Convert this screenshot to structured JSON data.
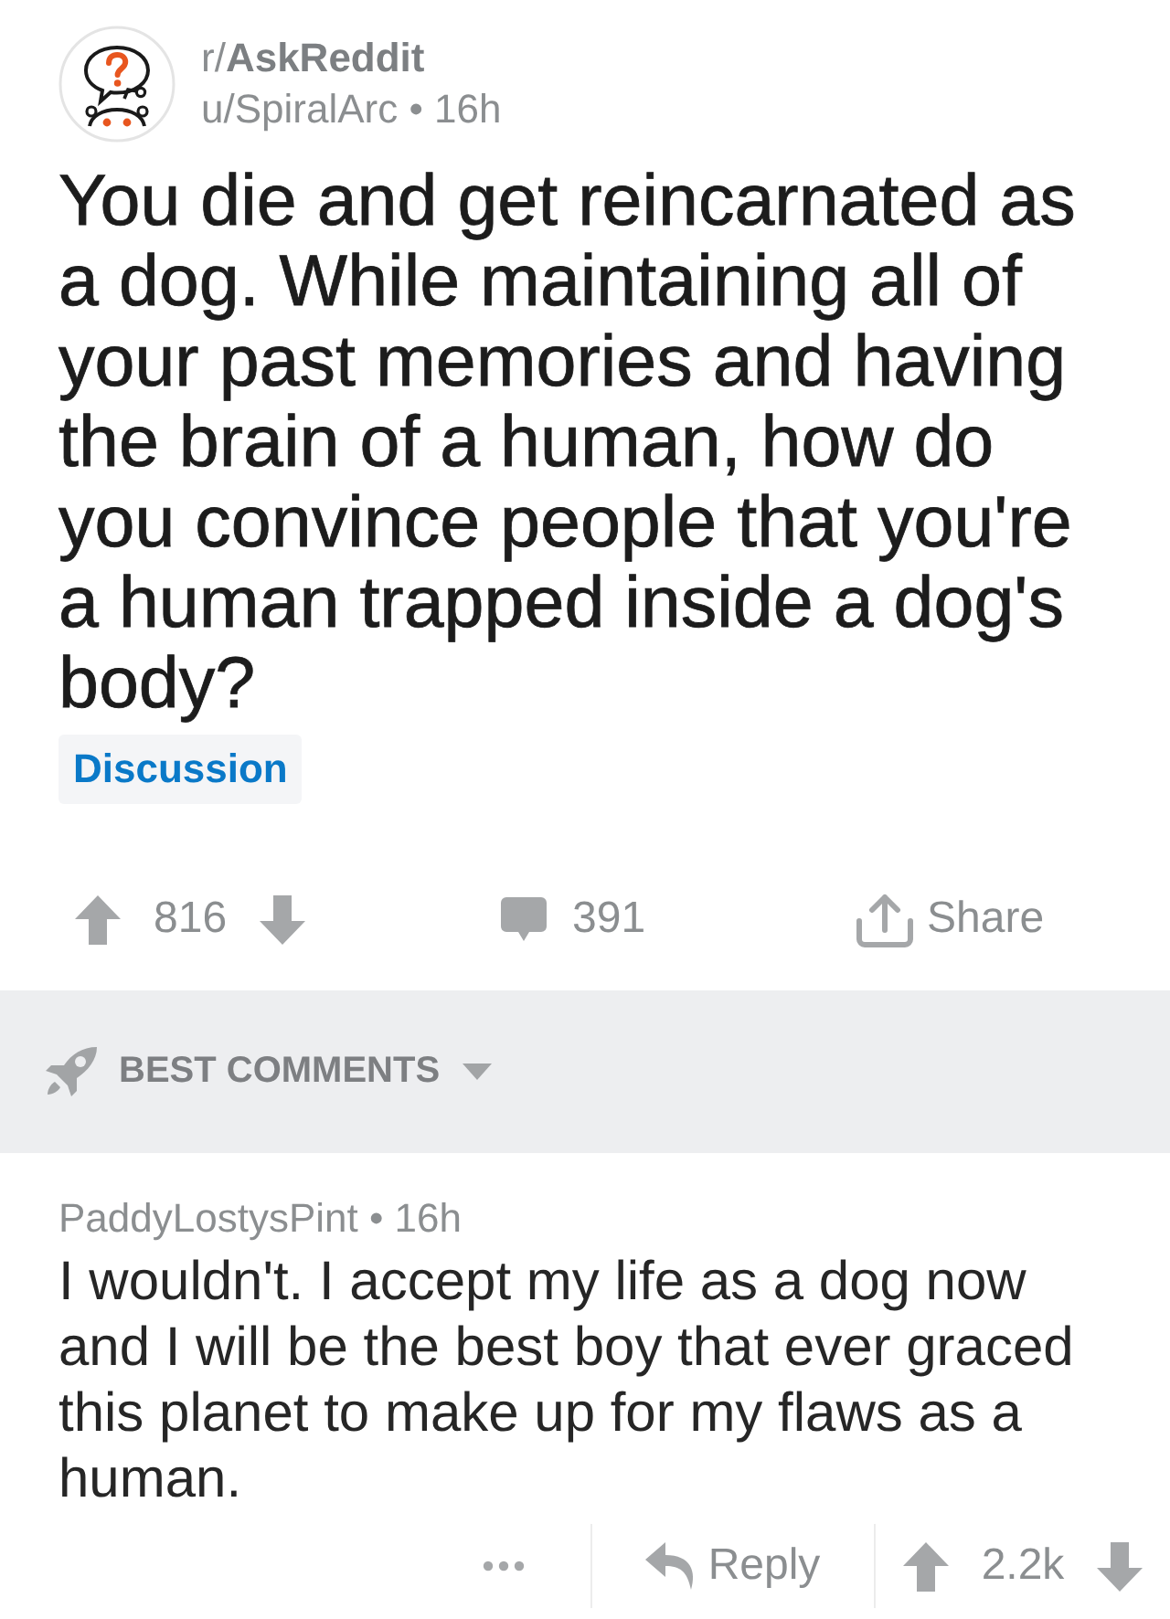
{
  "post": {
    "subreddit": "r/**AskReddit**",
    "byline": "u/SpiralArc • 16h",
    "title": "You die and get reincarnated as a dog. While maintaining all of your past memories and having the brain of a human, how do you convince people that you're a human trapped inside a dog's body?",
    "flair": "Discussion",
    "score": "816",
    "comments": "391",
    "share": "Share"
  },
  "sort": {
    "label": "BEST COMMENTS"
  },
  "comments": [
    {
      "byline": "PaddyLostysPint • 16h",
      "body": "I wouldn't. I accept my life as a dog now and I will be the best boy that ever graced this planet to make up for my flaws as a human.",
      "reply": "Reply",
      "score": "2.2k"
    }
  ]
}
